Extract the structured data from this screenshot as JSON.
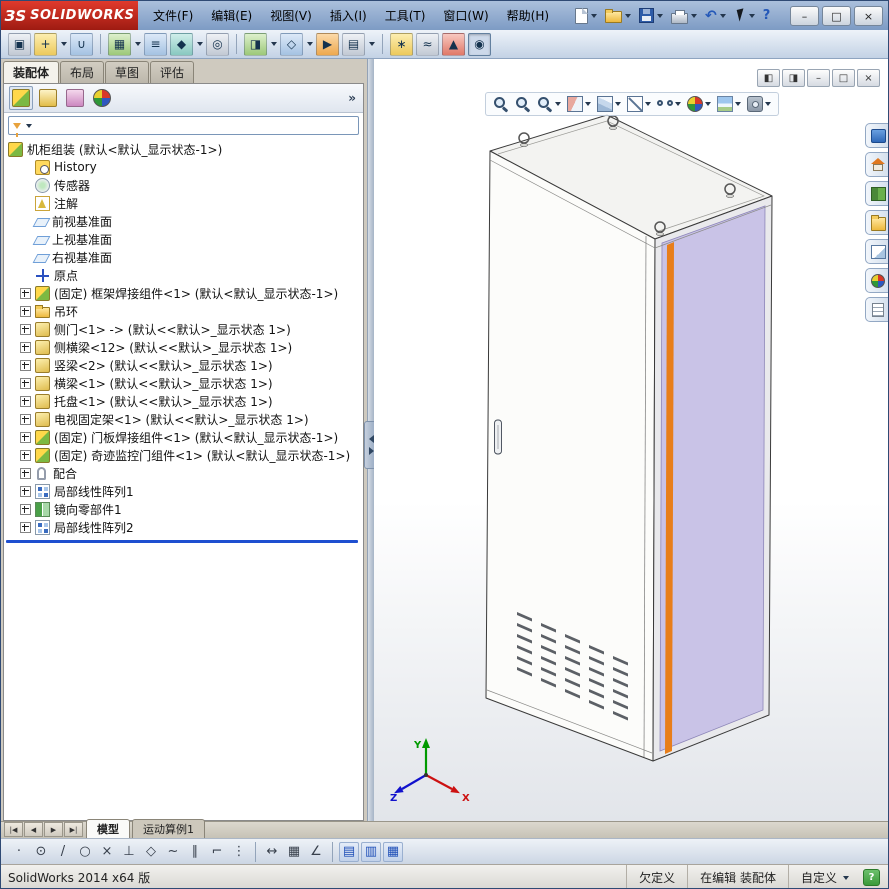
{
  "colors": {
    "accent_orange": "#e87e1a",
    "panel_lavender": "#c9c3e7",
    "rollback_blue": "#1e4fd0"
  },
  "titlebar": {
    "logo_mark": "ЗS",
    "logo_text": "SOLIDWORKS",
    "menus": [
      "文件(F)",
      "编辑(E)",
      "视图(V)",
      "插入(I)",
      "工具(T)",
      "窗口(W)",
      "帮助(H)"
    ],
    "quick_tools": [
      {
        "name": "new-document-button",
        "kind": "page",
        "dropdown": true
      },
      {
        "name": "open-document-button",
        "kind": "folder",
        "dropdown": true
      },
      {
        "name": "save-document-button",
        "kind": "disk",
        "dropdown": true
      },
      {
        "name": "print-document-button",
        "kind": "printer",
        "dropdown": true
      },
      {
        "name": "undo-button",
        "kind": "undo",
        "glyph": "↶",
        "dropdown": true
      },
      {
        "name": "select-button",
        "kind": "cursor",
        "dropdown": true
      },
      {
        "name": "help-button",
        "kind": "help",
        "glyph": "?",
        "dropdown": false
      }
    ],
    "window_buttons": [
      {
        "name": "minimize-button",
        "glyph": "–"
      },
      {
        "name": "restore-button",
        "glyph": "□"
      },
      {
        "name": "close-button",
        "glyph": "×"
      }
    ]
  },
  "assembly_toolbar": {
    "items": [
      {
        "name": "edit-component-button",
        "color": "gray",
        "glyph": "▣"
      },
      {
        "name": "insert-components-button",
        "color": "yellow",
        "glyph": "+",
        "dropdown": true
      },
      {
        "name": "mate-button",
        "color": "blue",
        "glyph": "∪"
      },
      {
        "sep": true
      },
      {
        "name": "linear-component-pattern-button",
        "color": "green",
        "glyph": "▦",
        "dropdown": true
      },
      {
        "name": "smart-fasteners-button",
        "color": "blue",
        "glyph": "≡"
      },
      {
        "name": "move-component-button",
        "color": "teal",
        "glyph": "◆",
        "dropdown": true
      },
      {
        "name": "show-hidden-components-button",
        "color": "gray",
        "glyph": "◎"
      },
      {
        "sep": true
      },
      {
        "name": "assembly-features-button",
        "color": "green",
        "glyph": "◨",
        "dropdown": true
      },
      {
        "name": "reference-geometry-button",
        "color": "blue",
        "glyph": "◇",
        "dropdown": true
      },
      {
        "name": "new-motion-study-button",
        "color": "orange",
        "glyph": "▶"
      },
      {
        "name": "bill-of-materials-button",
        "color": "gray",
        "glyph": "▤",
        "dropdown": true
      },
      {
        "sep": true
      },
      {
        "name": "exploded-view-button",
        "color": "yellow",
        "glyph": "∗"
      },
      {
        "name": "explode-line-sketch-button",
        "color": "gray",
        "glyph": "≈"
      },
      {
        "name": "interference-detection-button",
        "color": "red",
        "glyph": "▲"
      },
      {
        "name": "instant3d-button",
        "color": "teal",
        "glyph": "◉",
        "pressed": true
      }
    ]
  },
  "left_panel": {
    "tabs": [
      {
        "label": "装配体",
        "active": true
      },
      {
        "label": "布局",
        "active": false
      },
      {
        "label": "草图",
        "active": false
      },
      {
        "label": "评估",
        "active": false
      }
    ],
    "manager_tabs": [
      {
        "name": "featuremanager-tab",
        "kind": "tree",
        "active": true
      },
      {
        "name": "propertymanager-tab",
        "kind": "props",
        "active": false
      },
      {
        "name": "configurationmanager-tab",
        "kind": "config",
        "active": false
      },
      {
        "name": "displaymanager-tab",
        "kind": "ball",
        "active": false
      }
    ],
    "overflow_glyph": "»",
    "tree": {
      "items": [
        {
          "label": "机柜组装 (默认<默认_显示状态-1>)",
          "icon": "assembly",
          "exp": "none",
          "root": true
        },
        {
          "label": "History",
          "icon": "history",
          "exp": "none"
        },
        {
          "label": "传感器",
          "icon": "sensor",
          "exp": "none"
        },
        {
          "label": "注解",
          "icon": "annotation",
          "exp": "none"
        },
        {
          "label": "前视基准面",
          "icon": "plane",
          "exp": "none"
        },
        {
          "label": "上视基准面",
          "icon": "plane",
          "exp": "none"
        },
        {
          "label": "右视基准面",
          "icon": "plane",
          "exp": "none"
        },
        {
          "label": "原点",
          "icon": "origin",
          "exp": "none"
        },
        {
          "label": "(固定) 框架焊接组件<1> (默认<默认_显示状态-1>)",
          "icon": "subassembly",
          "exp": "plus"
        },
        {
          "label": "吊环",
          "icon": "folder",
          "exp": "plus"
        },
        {
          "label": "侧门<1> -> (默认<<默认>_显示状态 1>)",
          "icon": "part",
          "exp": "plus"
        },
        {
          "label": "侧横梁<12> (默认<<默认>_显示状态 1>)",
          "icon": "part",
          "exp": "plus"
        },
        {
          "label": "竖梁<2> (默认<<默认>_显示状态 1>)",
          "icon": "part",
          "exp": "plus"
        },
        {
          "label": "横梁<1> (默认<<默认>_显示状态 1>)",
          "icon": "part",
          "exp": "plus"
        },
        {
          "label": "托盘<1> (默认<<默认>_显示状态 1>)",
          "icon": "part",
          "exp": "plus"
        },
        {
          "label": "电视固定架<1> (默认<<默认>_显示状态 1>)",
          "icon": "part",
          "exp": "plus"
        },
        {
          "label": "(固定) 门板焊接组件<1> (默认<默认_显示状态-1>)",
          "icon": "subassembly",
          "exp": "plus"
        },
        {
          "label": "(固定) 奇迹监控门组件<1> (默认<默认_显示状态-1>)",
          "icon": "subassembly",
          "exp": "plus"
        },
        {
          "label": "配合",
          "icon": "mates",
          "exp": "plus"
        },
        {
          "label": "局部线性阵列1",
          "icon": "pattern",
          "exp": "plus"
        },
        {
          "label": "镜向零部件1",
          "icon": "mirror",
          "exp": "plus"
        },
        {
          "label": "局部线性阵列2",
          "icon": "pattern",
          "exp": "plus"
        }
      ]
    }
  },
  "viewport": {
    "headsup": [
      {
        "name": "zoom-to-fit-button",
        "kind": "mag",
        "dropdown": false
      },
      {
        "name": "zoom-to-area-button",
        "kind": "mag",
        "dropdown": false
      },
      {
        "name": "previous-view-button",
        "kind": "mag",
        "dropdown": true
      },
      {
        "name": "section-view-button",
        "kind": "section",
        "dropdown": true
      },
      {
        "name": "view-orientation-button",
        "kind": "cube",
        "dropdown": true
      },
      {
        "name": "display-style-button",
        "kind": "display",
        "dropdown": true
      },
      {
        "name": "hide-show-items-button",
        "kind": "glasses",
        "dropdown": true
      },
      {
        "name": "edit-appearance-button",
        "kind": "ball",
        "dropdown": true
      },
      {
        "name": "apply-scene-button",
        "kind": "scene",
        "dropdown": true
      },
      {
        "name": "view-settings-button",
        "kind": "camera",
        "dropdown": true
      }
    ],
    "doc_buttons": [
      {
        "name": "pane-left-button",
        "glyph": "◧"
      },
      {
        "name": "pane-right-button",
        "glyph": "◨"
      },
      {
        "name": "doc-minimize-button",
        "glyph": "–"
      },
      {
        "name": "doc-restore-button",
        "glyph": "□"
      },
      {
        "name": "doc-close-button",
        "glyph": "×"
      }
    ],
    "task_pane": [
      {
        "name": "solidworks-forum-tab",
        "kind": "forum"
      },
      {
        "name": "solidworks-resources-tab",
        "kind": "home"
      },
      {
        "name": "design-library-tab",
        "kind": "library"
      },
      {
        "name": "file-explorer-tab",
        "kind": "folder"
      },
      {
        "name": "view-palette-tab",
        "kind": "palette"
      },
      {
        "name": "appearances-scenes-tab",
        "kind": "ball"
      },
      {
        "name": "custom-properties-tab",
        "kind": "props"
      }
    ],
    "triad": {
      "x": "X",
      "y": "Y",
      "z": "Z"
    }
  },
  "model_tabs": {
    "nav": [
      {
        "name": "first-tab-button",
        "glyph": "|◀"
      },
      {
        "name": "prev-tab-button",
        "glyph": "◀"
      },
      {
        "name": "next-tab-button",
        "glyph": "▶"
      },
      {
        "name": "last-tab-button",
        "glyph": "▶|"
      }
    ],
    "tabs": [
      {
        "label": "模型",
        "active": true
      },
      {
        "label": "运动算例1",
        "active": false
      }
    ]
  },
  "sketch_toolbar": {
    "items": [
      {
        "name": "select-sketch-button",
        "glyph": "·"
      },
      {
        "name": "circle-point-button",
        "glyph": "⊙"
      },
      {
        "name": "line-button",
        "glyph": "/"
      },
      {
        "name": "circle-button",
        "glyph": "○"
      },
      {
        "name": "point-button",
        "glyph": "×"
      },
      {
        "name": "perpendicular-button",
        "glyph": "⊥"
      },
      {
        "name": "polygon-button",
        "glyph": "◇"
      },
      {
        "name": "spline-button",
        "glyph": "~"
      },
      {
        "name": "parallel-button",
        "glyph": "∥"
      },
      {
        "name": "corner-rectangle-button",
        "glyph": "⌐"
      },
      {
        "name": "snap-points-button",
        "glyph": "⋮"
      },
      {
        "sep": true
      },
      {
        "name": "smart-dimension-button",
        "glyph": "↔"
      },
      {
        "name": "grid-button",
        "glyph": "▦"
      },
      {
        "name": "angle-button",
        "glyph": "∠"
      },
      {
        "sep": true
      },
      {
        "name": "instant2d-button",
        "glyph": "▤",
        "blue": true
      },
      {
        "name": "tables-button",
        "glyph": "▥",
        "blue": true
      },
      {
        "name": "design-table-button",
        "glyph": "▦",
        "blue": true
      }
    ]
  },
  "status_bar": {
    "app_version": "SolidWorks 2014 x64 版",
    "cells": [
      {
        "name": "status-under-defined",
        "label": "欠定义",
        "interactable": false
      },
      {
        "name": "status-editing-scope",
        "label": "在编辑 装配体",
        "interactable": false
      },
      {
        "name": "status-custom-dropdown",
        "label": "自定义",
        "interactable": true,
        "dropdown": true
      }
    ],
    "help_glyph": "?"
  }
}
